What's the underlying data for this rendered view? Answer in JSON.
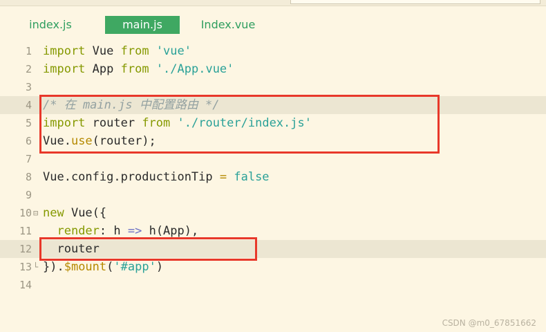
{
  "tabs": [
    {
      "label": "index.js",
      "active": false
    },
    {
      "label": "main.js",
      "active": true
    },
    {
      "label": "Index.vue",
      "active": false
    }
  ],
  "lines": [
    {
      "n": "1",
      "text": "import Vue from 'vue'"
    },
    {
      "n": "2",
      "text": "import App from './App.vue'"
    },
    {
      "n": "3",
      "text": ""
    },
    {
      "n": "4",
      "text": "/* 在 main.js 中配置路由 */"
    },
    {
      "n": "5",
      "text": "import router from './router/index.js'"
    },
    {
      "n": "6",
      "text": "Vue.use(router);"
    },
    {
      "n": "7",
      "text": ""
    },
    {
      "n": "8",
      "text": "Vue.config.productionTip = false"
    },
    {
      "n": "9",
      "text": ""
    },
    {
      "n": "10",
      "text": "new Vue({"
    },
    {
      "n": "11",
      "text": "  render: h => h(App),"
    },
    {
      "n": "12",
      "text": "  router"
    },
    {
      "n": "13",
      "text": "}).$mount('#app')"
    },
    {
      "n": "14",
      "text": ""
    }
  ],
  "watermark": "CSDN @m0_67851662",
  "colors": {
    "background": "#fdf6e3",
    "active_tab": "#3fa862",
    "annotation_box": "#e8382a"
  }
}
